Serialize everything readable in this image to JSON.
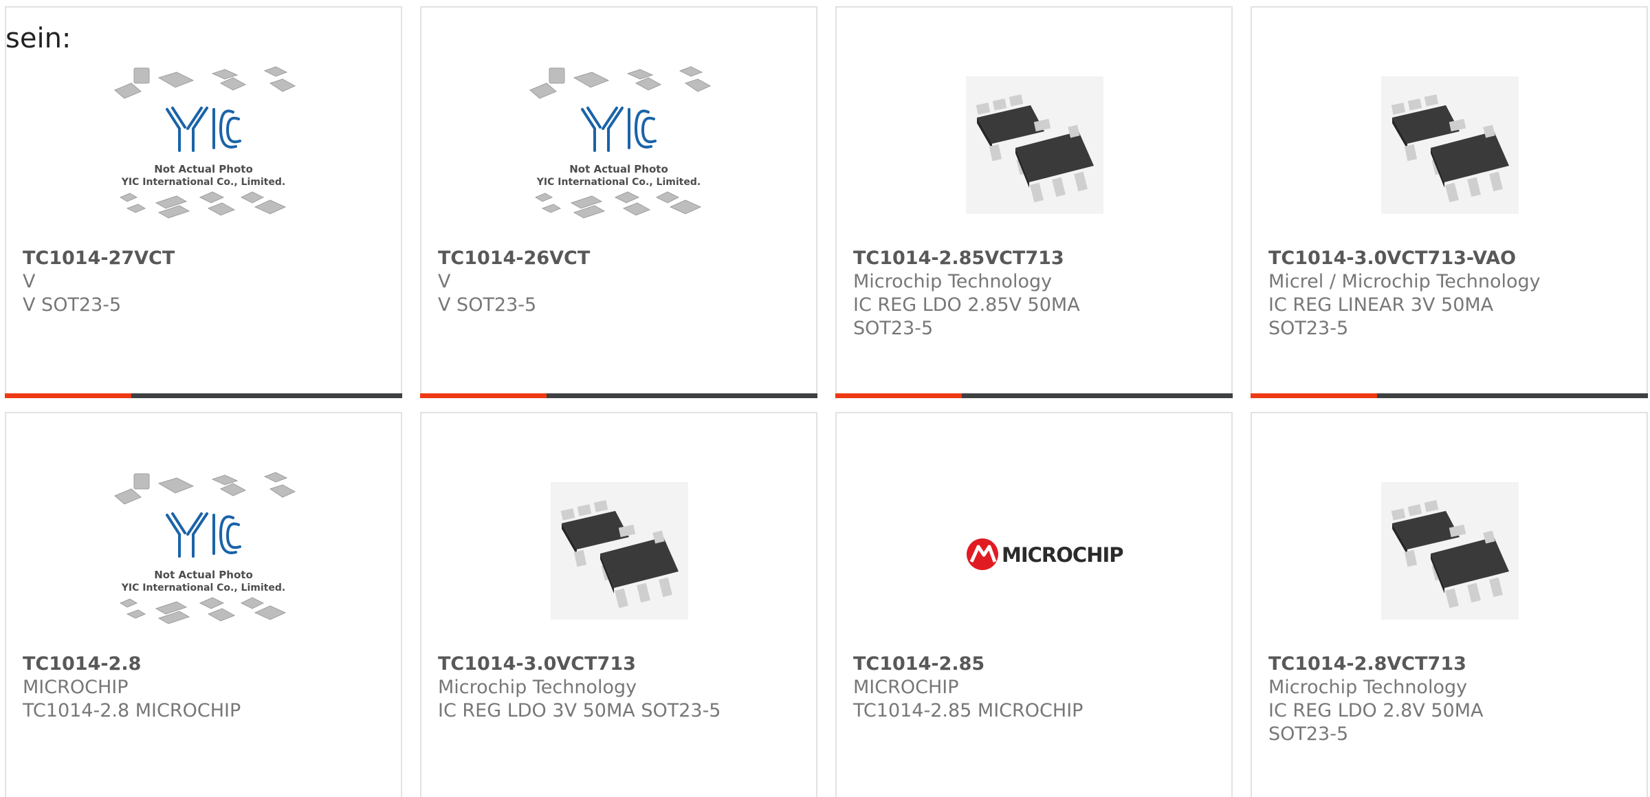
{
  "lead_text": "sein:",
  "colors": {
    "accent": "#ee3a14",
    "bar_dark": "#3f4042",
    "card_border": "#e2e2e2"
  },
  "placeholder": {
    "line1": "Not Actual Photo",
    "line2": "YIC International Co., Limited.",
    "brand": "YIC"
  },
  "microchip_logo_text": "MICROCHIP",
  "cards": [
    {
      "part": "TC1014-27VCT",
      "maker": "V",
      "desc": "V SOT23-5",
      "image": "yic-placeholder-image"
    },
    {
      "part": "TC1014-26VCT",
      "maker": "V",
      "desc": "V SOT23-5",
      "image": "yic-placeholder-image"
    },
    {
      "part": "TC1014-2.85VCT713",
      "maker": "Microchip Technology",
      "desc": "IC REG LDO 2.85V 50MA SOT23-5",
      "image": "sot23-5-chip-image"
    },
    {
      "part": "TC1014-3.0VCT713-VAO",
      "maker": "Micrel / Microchip Technology",
      "desc": "IC REG LINEAR 3V 50MA SOT23-5",
      "image": "sot23-5-chip-image"
    },
    {
      "part": "TC1014-2.8",
      "maker": "MICROCHIP",
      "desc": "TC1014-2.8 MICROCHIP",
      "image": "yic-placeholder-image"
    },
    {
      "part": "TC1014-3.0VCT713",
      "maker": "Microchip Technology",
      "desc": "IC REG LDO 3V 50MA SOT23-5",
      "image": "sot23-5-chip-image"
    },
    {
      "part": "TC1014-2.85",
      "maker": "MICROCHIP",
      "desc": "TC1014-2.85 MICROCHIP",
      "image": "microchip-logo-image"
    },
    {
      "part": "TC1014-2.8VCT713",
      "maker": "Microchip Technology",
      "desc": "IC REG LDO 2.8V 50MA SOT23-5",
      "image": "sot23-5-chip-image"
    }
  ]
}
